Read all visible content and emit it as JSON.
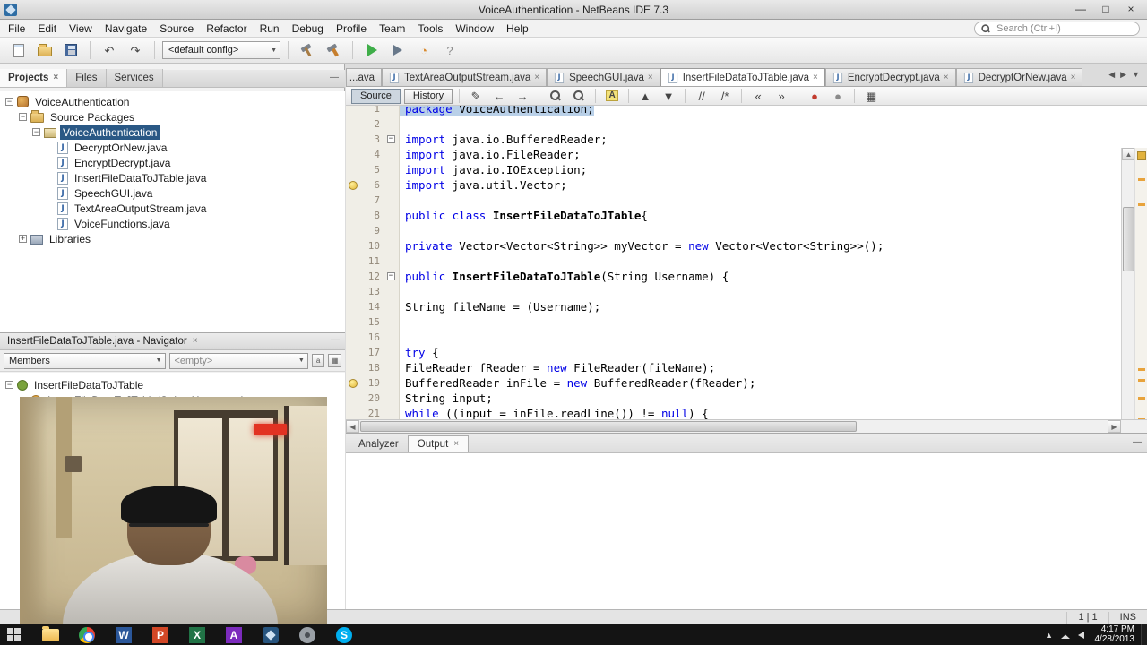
{
  "glyphs": {
    "close": "×",
    "minimize_panel": "—",
    "combo_arrow": "▼",
    "scroll_left": "◀",
    "scroll_right": "▶",
    "scroll_up": "▲",
    "scroll_down": "▼",
    "tab_list": "▼",
    "win_min": "—",
    "win_max": "□",
    "win_close": "×",
    "expand_open": "−",
    "expand_closed": "+",
    "fold": "−",
    "tray_up": "▲"
  },
  "window": {
    "title": "VoiceAuthentication - NetBeans IDE 7.3",
    "controls": [
      {
        "name": "minimize-button",
        "glyph": "—"
      },
      {
        "name": "maximize-button",
        "glyph": "□"
      },
      {
        "name": "close-button",
        "glyph": "×"
      }
    ]
  },
  "menubar": [
    "File",
    "Edit",
    "View",
    "Navigate",
    "Source",
    "Refactor",
    "Run",
    "Debug",
    "Profile",
    "Team",
    "Tools",
    "Window",
    "Help"
  ],
  "search": {
    "placeholder": "Search (Ctrl+I)"
  },
  "toolbar": {
    "config": "<default config>",
    "items": [
      {
        "t": "btn",
        "name": "new-file-icon",
        "css": "page"
      },
      {
        "t": "btn",
        "name": "open-project-icon",
        "css": "folder"
      },
      {
        "t": "btn",
        "name": "save-all-icon",
        "css": "disk"
      },
      {
        "t": "sep"
      },
      {
        "t": "btn",
        "name": "undo-icon",
        "g": "↶"
      },
      {
        "t": "btn",
        "name": "redo-icon",
        "g": "↷"
      },
      {
        "t": "sep"
      },
      {
        "t": "config"
      },
      {
        "t": "sep"
      },
      {
        "t": "btn",
        "name": "build-project-icon",
        "css": "hammer"
      },
      {
        "t": "btn",
        "name": "clean-build-icon",
        "css": "hammer2"
      },
      {
        "t": "sep"
      },
      {
        "t": "btn",
        "name": "run-project-icon",
        "css": "play"
      },
      {
        "t": "btn",
        "name": "debug-project-icon",
        "css": "playgray"
      },
      {
        "t": "btn",
        "name": "profile-project-icon",
        "g": "◔",
        "cls": "orange"
      },
      {
        "t": "btn",
        "name": "help-icon",
        "g": "?",
        "cls": "gray"
      }
    ]
  },
  "panels": {
    "projects": {
      "tabs": [
        {
          "label": "Projects",
          "active": true,
          "closable": true
        },
        {
          "label": "Files"
        },
        {
          "label": "Services"
        }
      ],
      "tree": [
        {
          "label": "VoiceAuthentication",
          "icon": "project",
          "depth": 0,
          "expand": "minus"
        },
        {
          "label": "Source Packages",
          "icon": "source-folder",
          "depth": 1,
          "expand": "minus"
        },
        {
          "label": "VoiceAuthentication",
          "icon": "package",
          "depth": 2,
          "expand": "minus",
          "selected": true
        },
        {
          "label": "DecryptOrNew.java",
          "icon": "java",
          "depth": 3
        },
        {
          "label": "EncryptDecrypt.java",
          "icon": "java",
          "depth": 3
        },
        {
          "label": "InsertFileDataToJTable.java",
          "icon": "java",
          "depth": 3
        },
        {
          "label": "SpeechGUI.java",
          "icon": "java",
          "depth": 3
        },
        {
          "label": "TextAreaOutputStream.java",
          "icon": "java",
          "depth": 3
        },
        {
          "label": "VoiceFunctions.java",
          "icon": "java",
          "depth": 3
        },
        {
          "label": "Libraries",
          "icon": "libraries",
          "depth": 1,
          "expand": "plus"
        }
      ]
    },
    "navigator": {
      "title": "InsertFileDataToJTable.java - Navigator",
      "members_label": "Members",
      "filter_value": "<empty>",
      "tree": [
        {
          "label": "InsertFileDataToJTable",
          "icon": "class",
          "depth": 0,
          "expand": "minus"
        },
        {
          "label": "InsertFileDataToJTable(String Username)",
          "icon": "constructor",
          "depth": 1
        }
      ]
    },
    "output": {
      "tabs": [
        {
          "label": "Analyzer"
        },
        {
          "label": "Output",
          "active": true,
          "closable": true
        }
      ]
    }
  },
  "editor": {
    "tabs": [
      {
        "label": "...ava",
        "partial": true
      },
      {
        "label": "TextAreaOutputStream.java",
        "closable": true
      },
      {
        "label": "SpeechGUI.java",
        "closable": true
      },
      {
        "label": "InsertFileDataToJTable.java",
        "closable": true,
        "active": true
      },
      {
        "label": "EncryptDecrypt.java",
        "closable": true
      },
      {
        "label": "DecryptOrNew.java",
        "closable": true
      }
    ],
    "views": [
      {
        "label": "Source",
        "active": true
      },
      {
        "label": "History"
      }
    ],
    "tools": [
      {
        "t": "btn",
        "name": "last-edit-icon",
        "g": "✎"
      },
      {
        "t": "btn",
        "name": "back-icon",
        "g": "←"
      },
      {
        "t": "btn",
        "name": "forward-icon",
        "g": "→"
      },
      {
        "t": "sep"
      },
      {
        "t": "btn",
        "name": "find-selection-icon",
        "css": "magnifier"
      },
      {
        "t": "btn",
        "name": "find-occurrences-icon",
        "css": "magnifier"
      },
      {
        "t": "sep"
      },
      {
        "t": "btn",
        "name": "toggle-highlight-icon",
        "g": "A",
        "cls": "hl"
      },
      {
        "t": "sep"
      },
      {
        "t": "btn",
        "name": "previous-occurrence-icon",
        "g": "▲"
      },
      {
        "t": "btn",
        "name": "next-occurrence-icon",
        "g": "▼"
      },
      {
        "t": "sep"
      },
      {
        "t": "btn",
        "name": "comment-icon",
        "g": "//"
      },
      {
        "t": "btn",
        "name": "uncomment-icon",
        "g": "/*"
      },
      {
        "t": "sep"
      },
      {
        "t": "btn",
        "name": "shift-left-icon",
        "g": "«"
      },
      {
        "t": "btn",
        "name": "shift-right-icon",
        "g": "»"
      },
      {
        "t": "sep"
      },
      {
        "t": "btn",
        "name": "record-macro-icon",
        "g": "●",
        "cls": "red"
      },
      {
        "t": "btn",
        "name": "run-macro-icon",
        "g": "●",
        "cls": "gray"
      },
      {
        "t": "sep"
      },
      {
        "t": "btn",
        "name": "diff-icon",
        "g": "▦"
      }
    ],
    "code": [
      {
        "n": 1,
        "sel": true,
        "tokens": [
          [
            "kw",
            "package"
          ],
          [
            "pl",
            " VoiceAuthentication;"
          ]
        ]
      },
      {
        "n": 2,
        "tokens": []
      },
      {
        "n": 3,
        "fold": true,
        "tokens": [
          [
            "kw",
            "import"
          ],
          [
            "pl",
            " java.io.BufferedReader;"
          ]
        ]
      },
      {
        "n": 4,
        "tokens": [
          [
            "kw",
            "import"
          ],
          [
            "pl",
            " java.io.FileReader;"
          ]
        ]
      },
      {
        "n": 5,
        "tokens": [
          [
            "kw",
            "import"
          ],
          [
            "pl",
            " java.io.IOException;"
          ]
        ]
      },
      {
        "n": 6,
        "warn": true,
        "tokens": [
          [
            "kw",
            "import"
          ],
          [
            "pl",
            " java.util.Vector;"
          ]
        ]
      },
      {
        "n": 7,
        "tokens": []
      },
      {
        "n": 8,
        "tokens": [
          [
            "kw",
            "public class"
          ],
          [
            "cl",
            " InsertFileDataToJTable"
          ],
          [
            "pl",
            "{"
          ]
        ]
      },
      {
        "n": 9,
        "tokens": []
      },
      {
        "n": 10,
        "tokens": [
          [
            "kw",
            "private"
          ],
          [
            "pl",
            " Vector<Vector<String>> myVector = "
          ],
          [
            "kw",
            "new"
          ],
          [
            "pl",
            " Vector<Vector<String>>();"
          ]
        ]
      },
      {
        "n": 11,
        "tokens": []
      },
      {
        "n": 12,
        "fold": true,
        "tokens": [
          [
            "kw",
            "public"
          ],
          [
            "cl",
            " InsertFileDataToJTable"
          ],
          [
            "pl",
            "(String Username) {"
          ]
        ]
      },
      {
        "n": 13,
        "tokens": []
      },
      {
        "n": 14,
        "tokens": [
          [
            "pl",
            "String fileName = (Username);"
          ]
        ]
      },
      {
        "n": 15,
        "tokens": []
      },
      {
        "n": 16,
        "tokens": []
      },
      {
        "n": 17,
        "tokens": [
          [
            "kw",
            "try"
          ],
          [
            "pl",
            " {"
          ]
        ]
      },
      {
        "n": 18,
        "tokens": [
          [
            "pl",
            "FileReader fReader = "
          ],
          [
            "kw",
            "new"
          ],
          [
            "pl",
            " FileReader(fileName);"
          ]
        ]
      },
      {
        "n": 19,
        "warn": true,
        "tokens": [
          [
            "pl",
            "BufferedReader inFile = "
          ],
          [
            "kw",
            "new"
          ],
          [
            "pl",
            " BufferedReader(fReader);"
          ]
        ]
      },
      {
        "n": 20,
        "tokens": [
          [
            "pl",
            "String input;"
          ]
        ]
      },
      {
        "n": 21,
        "tokens": [
          [
            "kw",
            "while"
          ],
          [
            "pl",
            " ((input = inFile.readLine()) != "
          ],
          [
            "kw",
            "null"
          ],
          [
            "pl",
            ") {"
          ]
        ]
      }
    ]
  },
  "statusbar": {
    "position": "1 | 1",
    "mode": "INS"
  },
  "taskbar": {
    "apps": [
      {
        "name": "file-explorer",
        "style": "folder2"
      },
      {
        "name": "browser",
        "style": "chrome"
      },
      {
        "name": "word",
        "style": "tile-blue",
        "letter": "W"
      },
      {
        "name": "powerpoint",
        "style": "tile-orange",
        "letter": "P"
      },
      {
        "name": "excel",
        "style": "tile-green",
        "letter": "X"
      },
      {
        "name": "app-purple",
        "style": "tile-purple",
        "letter": "A"
      },
      {
        "name": "netbeans",
        "style": "nb"
      },
      {
        "name": "control-panel",
        "style": "gear"
      },
      {
        "name": "skype",
        "style": "skype",
        "letter": "S"
      }
    ],
    "time": "4:17 PM",
    "date": "4/28/2013"
  }
}
